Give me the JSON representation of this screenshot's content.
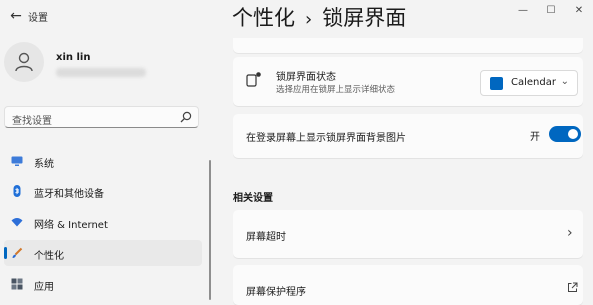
{
  "window": {
    "app_title": "设置",
    "back_icon": "back-arrow-icon",
    "controls": [
      "minimize-icon",
      "maximize-icon",
      "close-icon"
    ]
  },
  "user": {
    "name": "xin lin"
  },
  "search": {
    "placeholder": "查找设置",
    "icon": "search-icon"
  },
  "nav": {
    "items": [
      {
        "label": "系统",
        "icon": "system-icon",
        "color": "#3d7bd9"
      },
      {
        "label": "蓝牙和其他设备",
        "icon": "bluetooth-icon",
        "color": "#1f6fd8"
      },
      {
        "label": "网络 & Internet",
        "icon": "wifi-icon",
        "color": "#2d6fd8"
      },
      {
        "label": "个性化",
        "icon": "brush-icon",
        "color": "#d2782a",
        "selected": true
      },
      {
        "label": "应用",
        "icon": "apps-icon",
        "color": "#4a5563"
      }
    ]
  },
  "breadcrumb": {
    "parent": "个性化",
    "separator": "›",
    "current": "锁屏界面"
  },
  "lock_status": {
    "title": "锁屏界面状态",
    "subtitle": "选择应用在锁屏上显示详细状态",
    "dropdown_value": "Calendar",
    "dropdown_icon": "calendar-app-icon"
  },
  "background_toggle": {
    "title": "在登录屏幕上显示锁屏界面背景图片",
    "state_label": "开",
    "on": true
  },
  "related": {
    "section_title": "相关设置",
    "items": [
      {
        "label": "屏幕超时",
        "action_icon": "chevron-right-icon"
      },
      {
        "label": "屏幕保护程序",
        "action_icon": "external-link-icon"
      }
    ]
  },
  "colors": {
    "accent": "#0067c0",
    "background": "#f3f3f3",
    "card": "#fbfbfb"
  }
}
